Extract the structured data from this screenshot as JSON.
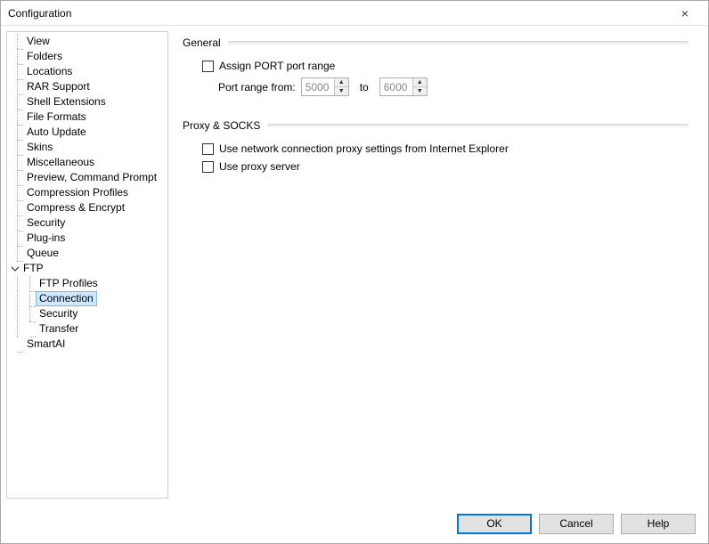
{
  "window": {
    "title": "Configuration",
    "close_icon": "×"
  },
  "tree": {
    "items": [
      {
        "label": "View"
      },
      {
        "label": "Folders"
      },
      {
        "label": "Locations"
      },
      {
        "label": "RAR Support"
      },
      {
        "label": "Shell Extensions"
      },
      {
        "label": "File Formats"
      },
      {
        "label": "Auto Update"
      },
      {
        "label": "Skins"
      },
      {
        "label": "Miscellaneous"
      },
      {
        "label": "Preview, Command Prompt"
      },
      {
        "label": "Compression Profiles"
      },
      {
        "label": "Compress & Encrypt"
      },
      {
        "label": "Security"
      },
      {
        "label": "Plug-ins"
      },
      {
        "label": "Queue"
      },
      {
        "label": "FTP",
        "expanded": true,
        "children": [
          {
            "label": "FTP Profiles"
          },
          {
            "label": "Connection",
            "selected": true
          },
          {
            "label": "Security"
          },
          {
            "label": "Transfer"
          }
        ]
      },
      {
        "label": "SmartAI"
      }
    ]
  },
  "panel": {
    "general": {
      "title": "General",
      "assign_port_label": "Assign PORT port range",
      "port_range_from_label": "Port range from:",
      "port_from": "5000",
      "to_label": "to",
      "port_to": "6000"
    },
    "proxy": {
      "title": "Proxy & SOCKS",
      "use_ie_label": "Use network connection proxy settings from Internet Explorer",
      "use_proxy_label": "Use proxy server"
    }
  },
  "buttons": {
    "ok": "OK",
    "cancel": "Cancel",
    "help": "Help"
  }
}
